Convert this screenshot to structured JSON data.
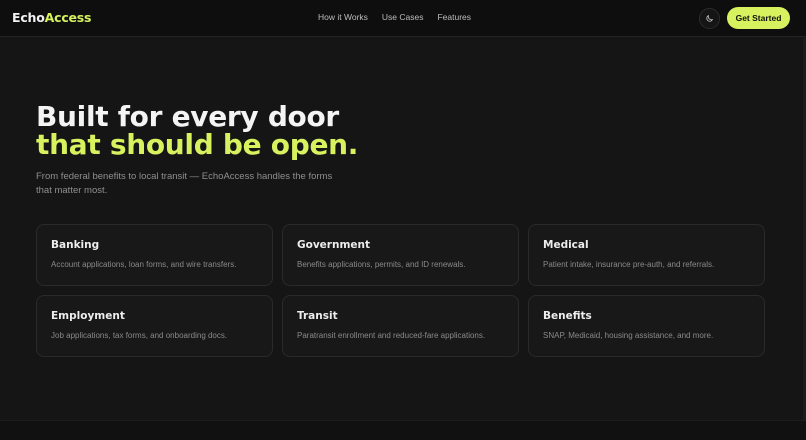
{
  "brand": {
    "name_prefix": "Echo",
    "name_suffix": "Access"
  },
  "nav": {
    "items": [
      "How it Works",
      "Use Cases",
      "Features"
    ]
  },
  "header": {
    "theme_toggle_icon": "moon-icon",
    "cta_label": "Get Started"
  },
  "colors": {
    "accent": "#d7f25e",
    "background": "#151515"
  },
  "hero": {
    "title_line1": "Built for every door",
    "title_line2": "that should be open.",
    "subtitle": "From federal benefits to local transit — EchoAccess handles the forms that matter most."
  },
  "cards": [
    {
      "title": "Banking",
      "desc": "Account applications, loan forms, and wire transfers."
    },
    {
      "title": "Government",
      "desc": "Benefits applications, permits, and ID renewals."
    },
    {
      "title": "Medical",
      "desc": "Patient intake, insurance pre-auth, and referrals."
    },
    {
      "title": "Employment",
      "desc": "Job applications, tax forms, and onboarding docs."
    },
    {
      "title": "Transit",
      "desc": "Paratransit enrollment and reduced-fare applications."
    },
    {
      "title": "Benefits",
      "desc": "SNAP, Medicaid, housing assistance, and more."
    }
  ]
}
